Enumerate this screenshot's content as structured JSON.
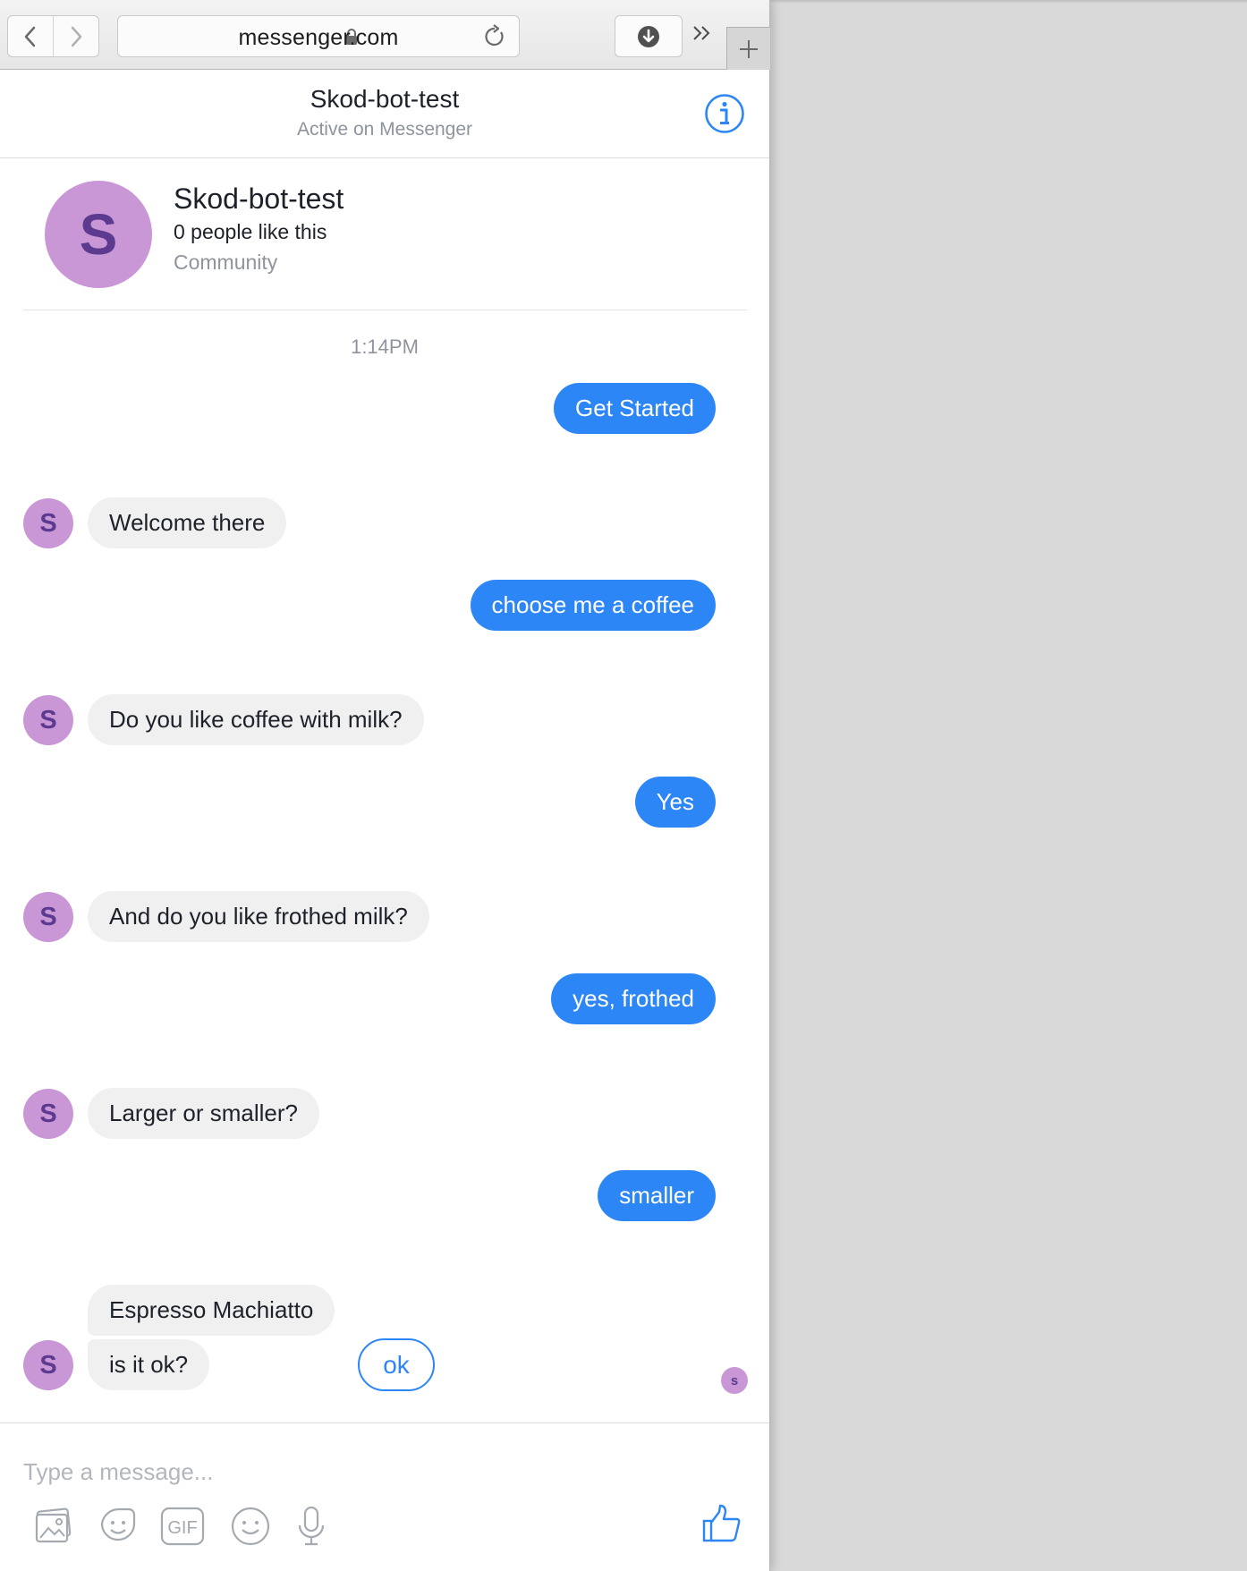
{
  "browser": {
    "url": "messenger.com",
    "back_icon": "chevron-left-icon",
    "forward_icon": "chevron-right-icon",
    "lock_icon": "lock-icon",
    "reload_icon": "reload-icon",
    "download_icon": "download-icon",
    "overflow_icon": "double-chevron-icon",
    "new_tab_icon": "plus-icon"
  },
  "conversation": {
    "title": "Skod-bot-test",
    "status": "Active on Messenger",
    "info_icon": "info-icon"
  },
  "page_profile": {
    "initial": "S",
    "name": "Skod-bot-test",
    "likes": "0 people like this",
    "category": "Community"
  },
  "timestamp": "1:14PM",
  "messages": [
    {
      "from": "me",
      "text": "Get Started"
    },
    {
      "from": "bot",
      "avatar": "S",
      "text": "Welcome there"
    },
    {
      "from": "me",
      "text": "choose me a coffee"
    },
    {
      "from": "bot",
      "avatar": "S",
      "text": "Do you like coffee with milk?"
    },
    {
      "from": "me",
      "text": "Yes"
    },
    {
      "from": "bot",
      "avatar": "S",
      "text": "And do you like frothed milk?"
    },
    {
      "from": "me",
      "text": "yes, frothed"
    },
    {
      "from": "bot",
      "avatar": "S",
      "text": "Larger or smaller?"
    },
    {
      "from": "me",
      "text": "smaller"
    },
    {
      "from": "bot",
      "text": "Espresso Machiatto"
    },
    {
      "from": "bot",
      "avatar": "S",
      "text": "is it ok?"
    }
  ],
  "quick_replies": [
    "ok"
  ],
  "seen_avatar": "s",
  "composer": {
    "placeholder": "Type a message...",
    "tools": [
      "photo-icon",
      "sticker-icon",
      "gif-icon",
      "emoji-icon",
      "microphone-icon"
    ],
    "gif_label": "GIF",
    "like_icon": "thumbs-up-icon"
  },
  "colors": {
    "accent": "#2d86f5",
    "avatar_bg": "#c997d6",
    "avatar_fg": "#5b3a8f",
    "incoming_bubble": "#f0f0f0"
  }
}
